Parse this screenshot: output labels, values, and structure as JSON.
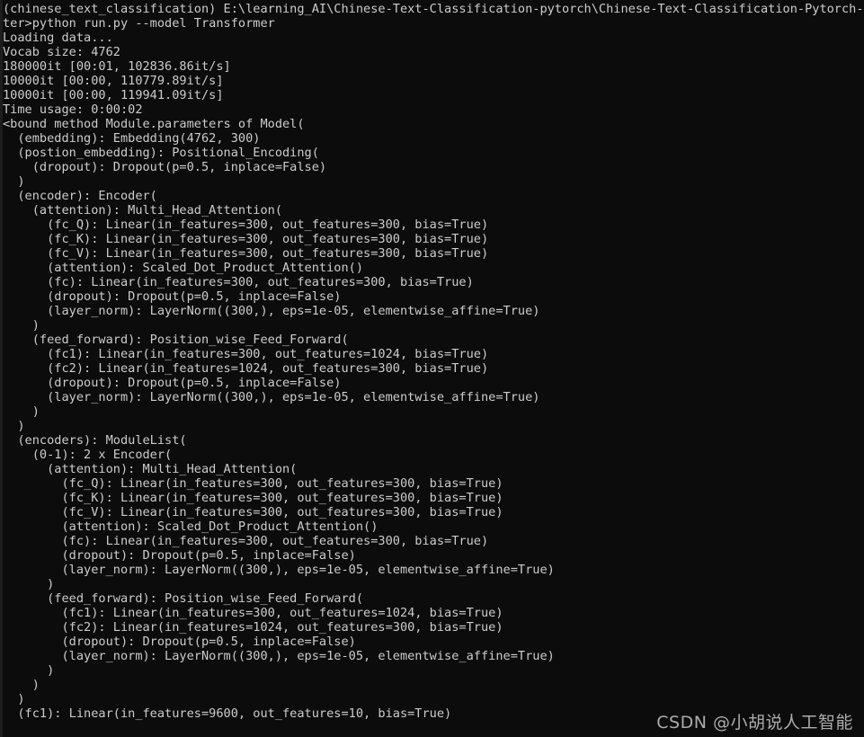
{
  "window": {
    "kind": "windows-command-prompt",
    "background_color": "#0c0c0c",
    "text_color": "#cccccc",
    "edge_strip_color": "#1d1d1d"
  },
  "terminal": {
    "prompt_env": "(chinese_text_classification)",
    "prompt_path": "E:\\learning_AI\\Chinese-Text-Classification-pytorch\\Chinese-Text-Classification-Pytorch-master",
    "command": "python run.py --model Transformer",
    "lines": [
      "(chinese_text_classification) E:\\learning_AI\\Chinese-Text-Classification-pytorch\\Chinese-Text-Classification-Pytorch-mas",
      "ter>python run.py --model Transformer",
      "Loading data...",
      "Vocab size: 4762",
      "180000it [00:01, 102836.86it/s]",
      "10000it [00:00, 110779.89it/s]",
      "10000it [00:00, 119941.09it/s]",
      "Time usage: 0:00:02",
      "<bound method Module.parameters of Model(",
      "  (embedding): Embedding(4762, 300)",
      "  (postion_embedding): Positional_Encoding(",
      "    (dropout): Dropout(p=0.5, inplace=False)",
      "  )",
      "  (encoder): Encoder(",
      "    (attention): Multi_Head_Attention(",
      "      (fc_Q): Linear(in_features=300, out_features=300, bias=True)",
      "      (fc_K): Linear(in_features=300, out_features=300, bias=True)",
      "      (fc_V): Linear(in_features=300, out_features=300, bias=True)",
      "      (attention): Scaled_Dot_Product_Attention()",
      "      (fc): Linear(in_features=300, out_features=300, bias=True)",
      "      (dropout): Dropout(p=0.5, inplace=False)",
      "      (layer_norm): LayerNorm((300,), eps=1e-05, elementwise_affine=True)",
      "    )",
      "    (feed_forward): Position_wise_Feed_Forward(",
      "      (fc1): Linear(in_features=300, out_features=1024, bias=True)",
      "      (fc2): Linear(in_features=1024, out_features=300, bias=True)",
      "      (dropout): Dropout(p=0.5, inplace=False)",
      "      (layer_norm): LayerNorm((300,), eps=1e-05, elementwise_affine=True)",
      "    )",
      "  )",
      "  (encoders): ModuleList(",
      "    (0-1): 2 x Encoder(",
      "      (attention): Multi_Head_Attention(",
      "        (fc_Q): Linear(in_features=300, out_features=300, bias=True)",
      "        (fc_K): Linear(in_features=300, out_features=300, bias=True)",
      "        (fc_V): Linear(in_features=300, out_features=300, bias=True)",
      "        (attention): Scaled_Dot_Product_Attention()",
      "        (fc): Linear(in_features=300, out_features=300, bias=True)",
      "        (dropout): Dropout(p=0.5, inplace=False)",
      "        (layer_norm): LayerNorm((300,), eps=1e-05, elementwise_affine=True)",
      "      )",
      "      (feed_forward): Position_wise_Feed_Forward(",
      "        (fc1): Linear(in_features=300, out_features=1024, bias=True)",
      "        (fc2): Linear(in_features=1024, out_features=300, bias=True)",
      "        (dropout): Dropout(p=0.5, inplace=False)",
      "        (layer_norm): LayerNorm((300,), eps=1e-05, elementwise_affine=True)",
      "      )",
      "    )",
      "  )",
      "  (fc1): Linear(in_features=9600, out_features=10, bias=True)"
    ]
  },
  "watermark": {
    "text": "CSDN @小胡说人工智能"
  }
}
